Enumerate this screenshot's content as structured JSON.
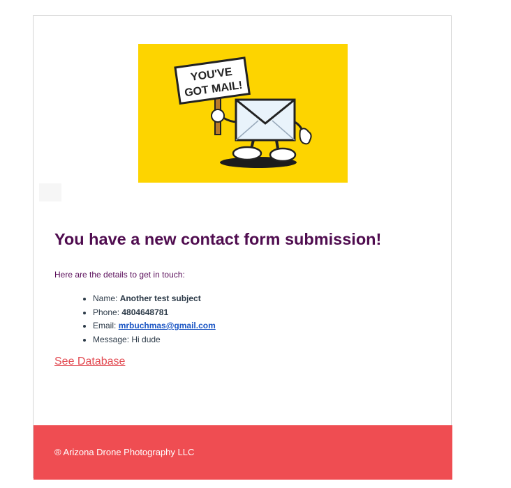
{
  "hero": {
    "sign_line1": "YOU'VE",
    "sign_line2": "GOT MAIL!",
    "background_color": "#fdd400"
  },
  "heading": "You have a new contact form submission!",
  "intro": "Here are the details to get in touch:",
  "details": [
    {
      "label": "Name: ",
      "value": "Another test subject"
    },
    {
      "label": "Phone: ",
      "value": "4804648781"
    },
    {
      "label": "Email: ",
      "value": "mrbuchmas@gmail.com"
    },
    {
      "label": "Message: ",
      "value": "Hi dude"
    }
  ],
  "database_link": "See Database",
  "footer": {
    "text": "® Arizona Drone Photography LLC",
    "background_color": "#ef4d52"
  },
  "colors": {
    "heading": "#4f0c4f",
    "link": "#e24a51",
    "email_link": "#1a55c4"
  }
}
